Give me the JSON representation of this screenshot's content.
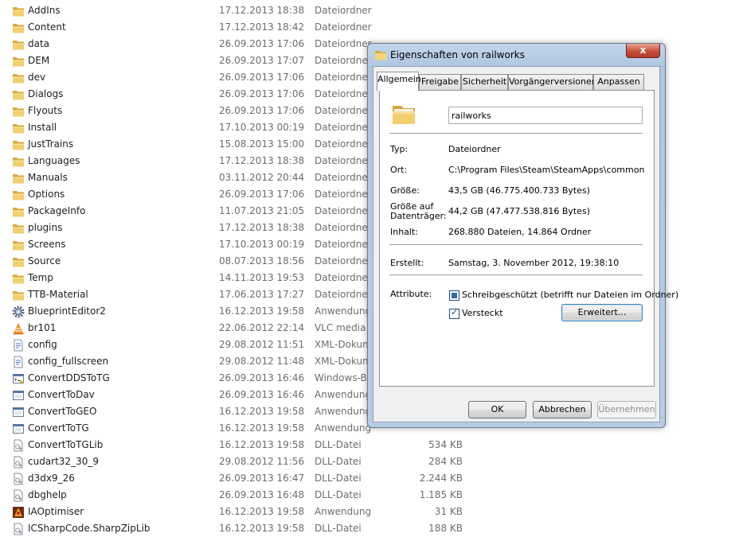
{
  "files": [
    {
      "name": "AddIns",
      "date": "17.12.2013 18:38",
      "type": "Dateiordner",
      "size": "",
      "icon": "folder"
    },
    {
      "name": "Content",
      "date": "17.12.2013 18:42",
      "type": "Dateiordner",
      "size": "",
      "icon": "folder"
    },
    {
      "name": "data",
      "date": "26.09.2013 17:06",
      "type": "Dateiordner",
      "size": "",
      "icon": "folder"
    },
    {
      "name": "DEM",
      "date": "26.09.2013 17:07",
      "type": "Dateiordner",
      "size": "",
      "icon": "folder"
    },
    {
      "name": "dev",
      "date": "26.09.2013 17:06",
      "type": "Dateiordner",
      "size": "",
      "icon": "folder"
    },
    {
      "name": "Dialogs",
      "date": "26.09.2013 17:06",
      "type": "Dateiordner",
      "size": "",
      "icon": "folder"
    },
    {
      "name": "Flyouts",
      "date": "26.09.2013 17:06",
      "type": "Dateiordner",
      "size": "",
      "icon": "folder"
    },
    {
      "name": "Install",
      "date": "17.10.2013 00:19",
      "type": "Dateiordner",
      "size": "",
      "icon": "folder"
    },
    {
      "name": "JustTrains",
      "date": "15.08.2013 15:00",
      "type": "Dateiordner",
      "size": "",
      "icon": "folder"
    },
    {
      "name": "Languages",
      "date": "17.12.2013 18:38",
      "type": "Dateiordner",
      "size": "",
      "icon": "folder"
    },
    {
      "name": "Manuals",
      "date": "03.11.2012 20:44",
      "type": "Dateiordner",
      "size": "",
      "icon": "folder"
    },
    {
      "name": "Options",
      "date": "26.09.2013 17:06",
      "type": "Dateiordner",
      "size": "",
      "icon": "folder"
    },
    {
      "name": "PackageInfo",
      "date": "11.07.2013 21:05",
      "type": "Dateiordner",
      "size": "",
      "icon": "folder"
    },
    {
      "name": "plugins",
      "date": "17.12.2013 18:38",
      "type": "Dateiordner",
      "size": "",
      "icon": "folder"
    },
    {
      "name": "Screens",
      "date": "17.10.2013 00:19",
      "type": "Dateiordner",
      "size": "",
      "icon": "folder"
    },
    {
      "name": "Source",
      "date": "08.07.2013 18:56",
      "type": "Dateiordner",
      "size": "",
      "icon": "folder"
    },
    {
      "name": "Temp",
      "date": "14.11.2013 19:53",
      "type": "Dateiordner",
      "size": "",
      "icon": "folder"
    },
    {
      "name": "TTB-Material",
      "date": "17.06.2013 17:27",
      "type": "Dateiordner",
      "size": "",
      "icon": "folder"
    },
    {
      "name": "BlueprintEditor2",
      "date": "16.12.2013 19:58",
      "type": "Anwendung",
      "size": "",
      "icon": "gear"
    },
    {
      "name": "br101",
      "date": "22.06.2012 22:14",
      "type": "VLC media f",
      "size": "",
      "icon": "vlc"
    },
    {
      "name": "config",
      "date": "29.08.2012 11:51",
      "type": "XML-Dokum",
      "size": "",
      "icon": "xml"
    },
    {
      "name": "config_fullscreen",
      "date": "29.08.2012 11:48",
      "type": "XML-Dokum",
      "size": "",
      "icon": "xml"
    },
    {
      "name": "ConvertDDSToTG",
      "date": "26.09.2013 16:46",
      "type": "Windows-Ba",
      "size": "",
      "icon": "batch"
    },
    {
      "name": "ConvertToDav",
      "date": "26.09.2013 16:46",
      "type": "Anwendung",
      "size": "",
      "icon": "app"
    },
    {
      "name": "ConvertToGEO",
      "date": "16.12.2013 19:58",
      "type": "Anwendung",
      "size": "",
      "icon": "app"
    },
    {
      "name": "ConvertToTG",
      "date": "16.12.2013 19:58",
      "type": "Anwendung",
      "size": "",
      "icon": "app"
    },
    {
      "name": "ConvertToTGLib",
      "date": "16.12.2013 19:58",
      "type": "DLL-Datei",
      "size": "534 KB",
      "icon": "dll"
    },
    {
      "name": "cudart32_30_9",
      "date": "29.08.2012 11:56",
      "type": "DLL-Datei",
      "size": "284 KB",
      "icon": "dll"
    },
    {
      "name": "d3dx9_26",
      "date": "26.09.2013 16:47",
      "type": "DLL-Datei",
      "size": "2.244 KB",
      "icon": "dll"
    },
    {
      "name": "dbghelp",
      "date": "26.09.2013 16:48",
      "type": "DLL-Datei",
      "size": "1.185 KB",
      "icon": "dll"
    },
    {
      "name": "IAOptimiser",
      "date": "16.12.2013 19:58",
      "type": "Anwendung",
      "size": "31 KB",
      "icon": "iaopt"
    },
    {
      "name": "ICSharpCode.SharpZipLib",
      "date": "16.12.2013 19:58",
      "type": "DLL-Datei",
      "size": "188 KB",
      "icon": "dll"
    }
  ],
  "dialog": {
    "title": "Eigenschaften von railworks",
    "close_label": "x",
    "tabs": [
      "Allgemein",
      "Freigabe",
      "Sicherheit",
      "Vorgängerversionen",
      "Anpassen"
    ],
    "active_tab": "Allgemein",
    "folder_name": "railworks",
    "props": {
      "type_label": "Typ:",
      "type_value": "Dateiordner",
      "location_label": "Ort:",
      "location_value": "C:\\Program Files\\Steam\\SteamApps\\common",
      "size_label": "Größe:",
      "size_value": "43,5 GB (46.775.400.733 Bytes)",
      "disk_size_label_1": "Größe auf",
      "disk_size_label_2": "Datenträger:",
      "disk_size_value": "44,2 GB (47.477.538.816 Bytes)",
      "contents_label": "Inhalt:",
      "contents_value": "268.880 Dateien, 14.864 Ordner",
      "created_label": "Erstellt:",
      "created_value": "Samstag, 3. November 2012, 19:38:10",
      "attributes_label": "Attribute:"
    },
    "attributes": {
      "readonly_label": "Schreibgeschützt (betrifft nur Dateien im Ordner)",
      "readonly_state": "indeterminate",
      "hidden_label": "Versteckt",
      "hidden_checked": true,
      "advanced_label": "Erweitert..."
    },
    "buttons": {
      "ok": "OK",
      "cancel": "Abbrechen",
      "apply": "Übernehmen"
    }
  },
  "colors": {
    "accent": "#3c7fb1",
    "folder": "#e8c45c",
    "close": "#c7503a"
  }
}
